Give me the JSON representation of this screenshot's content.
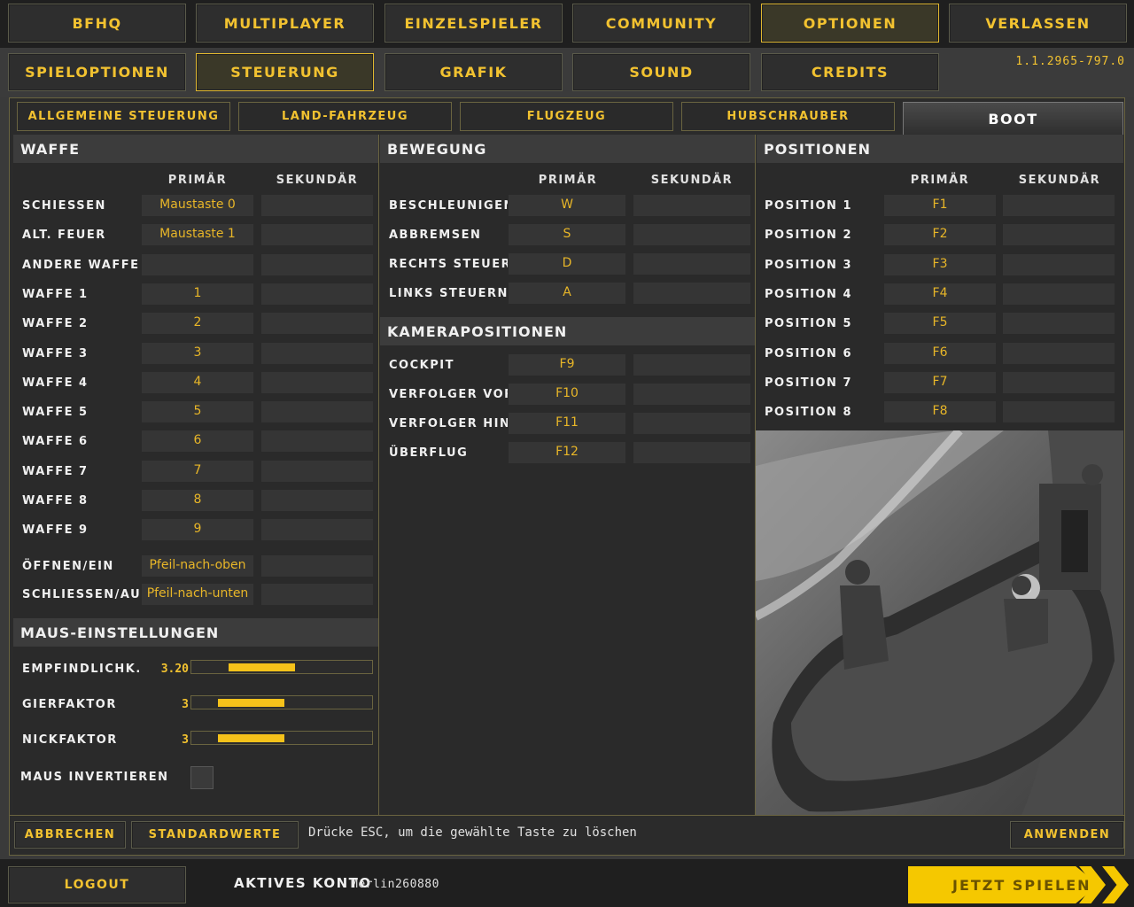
{
  "top_nav": [
    "BFHQ",
    "MULTIPLAYER",
    "EINZELSPIELER",
    "COMMUNITY",
    "OPTIONEN",
    "VERLASSEN"
  ],
  "sub_nav": [
    "SPIELOPTIONEN",
    "STEUERUNG",
    "GRAFIK",
    "SOUND",
    "CREDITS"
  ],
  "version": "1.1.2965-797.0",
  "tabs": [
    "ALLGEMEINE STEUERUNG",
    "LAND-FAHRZEUG",
    "FLUGZEUG",
    "HUBSCHRAUBER",
    "BOOT"
  ],
  "col_primary": "PRIMÄR",
  "col_secondary": "SEKUNDÄR",
  "waffe": {
    "title": "WAFFE",
    "rows": [
      {
        "label": "SCHIESSEN",
        "primary": "Maustaste 0",
        "secondary": ""
      },
      {
        "label": "ALT. FEUER",
        "primary": "Maustaste 1",
        "secondary": ""
      },
      {
        "label": "ANDERE WAFFE",
        "primary": "",
        "secondary": ""
      },
      {
        "label": "WAFFE 1",
        "primary": "1",
        "secondary": ""
      },
      {
        "label": "WAFFE 2",
        "primary": "2",
        "secondary": ""
      },
      {
        "label": "WAFFE 3",
        "primary": "3",
        "secondary": ""
      },
      {
        "label": "WAFFE 4",
        "primary": "4",
        "secondary": ""
      },
      {
        "label": "WAFFE 5",
        "primary": "5",
        "secondary": ""
      },
      {
        "label": "WAFFE 6",
        "primary": "6",
        "secondary": ""
      },
      {
        "label": "WAFFE 7",
        "primary": "7",
        "secondary": ""
      },
      {
        "label": "WAFFE 8",
        "primary": "8",
        "secondary": ""
      },
      {
        "label": "WAFFE 9",
        "primary": "9",
        "secondary": ""
      },
      {
        "label": "ÖFFNEN/EIN",
        "primary": "Pfeil-nach-oben",
        "secondary": ""
      },
      {
        "label": "SCHLIESSEN/AUS",
        "primary": "Pfeil-nach-unten",
        "secondary": ""
      }
    ]
  },
  "maus": {
    "title": "MAUS-EINSTELLUNGEN",
    "sensitivity_label": "EMPFINDLICHK.",
    "sensitivity_value": "3.20",
    "yaw_label": "GIERFAKTOR",
    "yaw_value": "3",
    "pitch_label": "NICKFAKTOR",
    "pitch_value": "3",
    "invert_label": "MAUS INVERTIEREN"
  },
  "bewegung": {
    "title": "BEWEGUNG",
    "rows": [
      {
        "label": "BESCHLEUNIGEN",
        "primary": "W",
        "secondary": ""
      },
      {
        "label": "ABBREMSEN",
        "primary": "S",
        "secondary": ""
      },
      {
        "label": "RECHTS STEUERN",
        "primary": "D",
        "secondary": ""
      },
      {
        "label": "LINKS STEUERN",
        "primary": "A",
        "secondary": ""
      }
    ]
  },
  "kamera": {
    "title": "KAMERAPOSITIONEN",
    "rows": [
      {
        "label": "COCKPIT",
        "primary": "F9",
        "secondary": ""
      },
      {
        "label": "VERFOLGER VORNE",
        "primary": "F10",
        "secondary": ""
      },
      {
        "label": "VERFOLGER HINTE",
        "primary": "F11",
        "secondary": ""
      },
      {
        "label": "ÜBERFLUG",
        "primary": "F12",
        "secondary": ""
      }
    ]
  },
  "positionen": {
    "title": "POSITIONEN",
    "rows": [
      {
        "label": "POSITION 1",
        "primary": "F1",
        "secondary": ""
      },
      {
        "label": "POSITION 2",
        "primary": "F2",
        "secondary": ""
      },
      {
        "label": "POSITION 3",
        "primary": "F3",
        "secondary": ""
      },
      {
        "label": "POSITION 4",
        "primary": "F4",
        "secondary": ""
      },
      {
        "label": "POSITION 5",
        "primary": "F5",
        "secondary": ""
      },
      {
        "label": "POSITION 6",
        "primary": "F6",
        "secondary": ""
      },
      {
        "label": "POSITION 7",
        "primary": "F7",
        "secondary": ""
      },
      {
        "label": "POSITION 8",
        "primary": "F8",
        "secondary": ""
      }
    ]
  },
  "footer": {
    "cancel": "ABBRECHEN",
    "defaults": "STANDARDWERTE",
    "hint": "Drücke ESC, um die gewählte Taste zu löschen",
    "apply": "ANWENDEN"
  },
  "bottom": {
    "logout": "LOGOUT",
    "account_label": "AKTIVES KONTO",
    "account_name": "Merlin260880",
    "play": "JETZT SPIELEN"
  },
  "colors": {
    "accent": "#f2c230",
    "play": "#f5c800",
    "panel": "#2a2a2a"
  }
}
